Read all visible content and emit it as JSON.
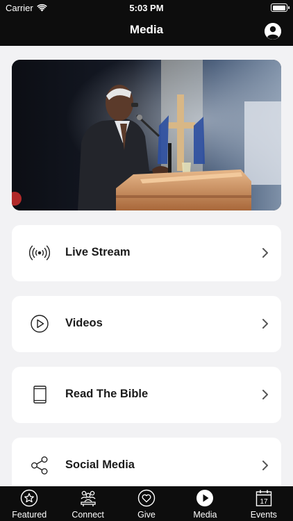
{
  "status_bar": {
    "carrier": "Carrier",
    "time": "5:03 PM"
  },
  "header": {
    "title": "Media"
  },
  "menu": [
    {
      "label": "Live Stream",
      "icon": "broadcast-icon"
    },
    {
      "label": "Videos",
      "icon": "play-circle-icon"
    },
    {
      "label": "Read The Bible",
      "icon": "book-icon"
    },
    {
      "label": "Social Media",
      "icon": "share-icon"
    }
  ],
  "tabs": [
    {
      "label": "Featured",
      "icon": "star-icon",
      "active": false
    },
    {
      "label": "Connect",
      "icon": "people-icon",
      "active": false
    },
    {
      "label": "Give",
      "icon": "heart-icon",
      "active": false
    },
    {
      "label": "Media",
      "icon": "play-icon",
      "active": true
    },
    {
      "label": "Events",
      "icon": "calendar-icon",
      "active": false
    }
  ],
  "calendar_day": "17",
  "colors": {
    "bar_background": "#0d0d0d",
    "page_background": "#f2f2f4",
    "card_background": "#ffffff"
  }
}
